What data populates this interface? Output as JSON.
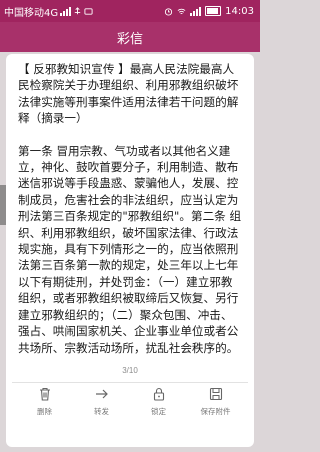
{
  "status_bar": {
    "carrier": "中国移动4G",
    "time": "14:03"
  },
  "header": {
    "title": "彩信"
  },
  "message": {
    "paragraph_1": "【 反邪教知识宣传 】最高人民法院最高人民检察院关于办理组织、利用邪教组织破坏法律实施等刑事案件适用法律若干问题的解释（摘录一）",
    "paragraph_2": "第一条 冒用宗教、气功或者以其他名义建立，神化、鼓吹首要分子，利用制造、散布迷信邪说等手段蛊惑、蒙骗他人，发展、控制成员，危害社会的非法组织，应当认定为刑法第三百条规定的\"邪教组织\"。第二条 组织、利用邪教组织，破坏国家法律、行政法规实施，具有下列情形之一的，应当依照刑法第三百条第一款的规定，处三年以上七年以下有期徒刑，并处罚金：（一）建立邪教组织，或者邪教组织被取缔后又恢复、另行建立邪教组织的；（二）聚众包围、冲击、强占、哄闹国家机关、企业事业单位或者公共场所、宗教活动场所，扰乱社会秩序的。"
  },
  "pagination": {
    "indicator": "3/10"
  },
  "actions": [
    {
      "label": "删除",
      "icon": "trash-icon"
    },
    {
      "label": "转发",
      "icon": "forward-arrow-icon"
    },
    {
      "label": "锁定",
      "icon": "lock-icon"
    },
    {
      "label": "保存附件",
      "icon": "save-icon"
    }
  ],
  "colors": {
    "status_bar": "#a0245f",
    "title_bar": "#a8316a",
    "background": "#dcd6d8"
  }
}
